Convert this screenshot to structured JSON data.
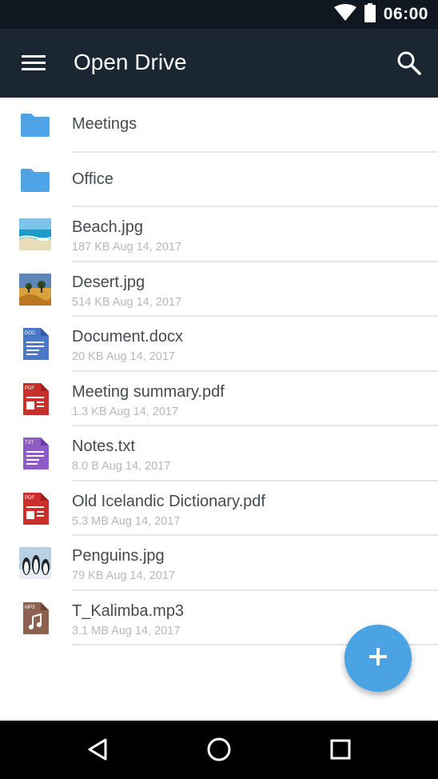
{
  "status_bar": {
    "time": "06:00",
    "icons": [
      "wifi-icon",
      "battery-icon"
    ]
  },
  "app_bar": {
    "title": "Open Drive",
    "menu_icon": "menu-icon",
    "search_icon": "search-icon"
  },
  "colors": {
    "app_bar": "#1a2733",
    "status_bar": "#0f1821",
    "fab": "#4aa3e3",
    "folder": "#4ea4e6"
  },
  "items": [
    {
      "name": "Meetings",
      "type": "folder",
      "icon": "folder-icon"
    },
    {
      "name": "Office",
      "type": "folder",
      "icon": "folder-icon"
    },
    {
      "name": "Beach.jpg",
      "meta": "187 KB Aug 14, 2017",
      "type": "image",
      "icon": "beach-image-thumbnail"
    },
    {
      "name": "Desert.jpg",
      "meta": "514 KB Aug 14, 2017",
      "type": "image",
      "icon": "desert-image-thumbnail"
    },
    {
      "name": "Document.docx",
      "meta": "20 KB Aug 14, 2017",
      "type": "doc",
      "icon": "doc-file-icon",
      "badge": "DOC"
    },
    {
      "name": "Meeting summary.pdf",
      "meta": "1.3 KB Aug 14, 2017",
      "type": "pdf",
      "icon": "pdf-file-icon",
      "badge": "PDF"
    },
    {
      "name": "Notes.txt",
      "meta": "8.0 B Aug 14, 2017",
      "type": "txt",
      "icon": "txt-file-icon",
      "badge": "TXT"
    },
    {
      "name": "Old Icelandic Dictionary.pdf",
      "meta": "5.3 MB Aug 14, 2017",
      "type": "pdf",
      "icon": "pdf-file-icon",
      "badge": "PDF"
    },
    {
      "name": "Penguins.jpg",
      "meta": "79 KB Aug 14, 2017",
      "type": "image",
      "icon": "penguins-image-thumbnail"
    },
    {
      "name": "T_Kalimba.mp3",
      "meta": "3.1 MB Aug 14, 2017",
      "type": "mp3",
      "icon": "mp3-file-icon",
      "badge": "MP3"
    }
  ],
  "fab": {
    "icon": "add-icon"
  },
  "nav_bar": {
    "icons": [
      "back-icon",
      "home-icon",
      "recents-icon"
    ]
  }
}
